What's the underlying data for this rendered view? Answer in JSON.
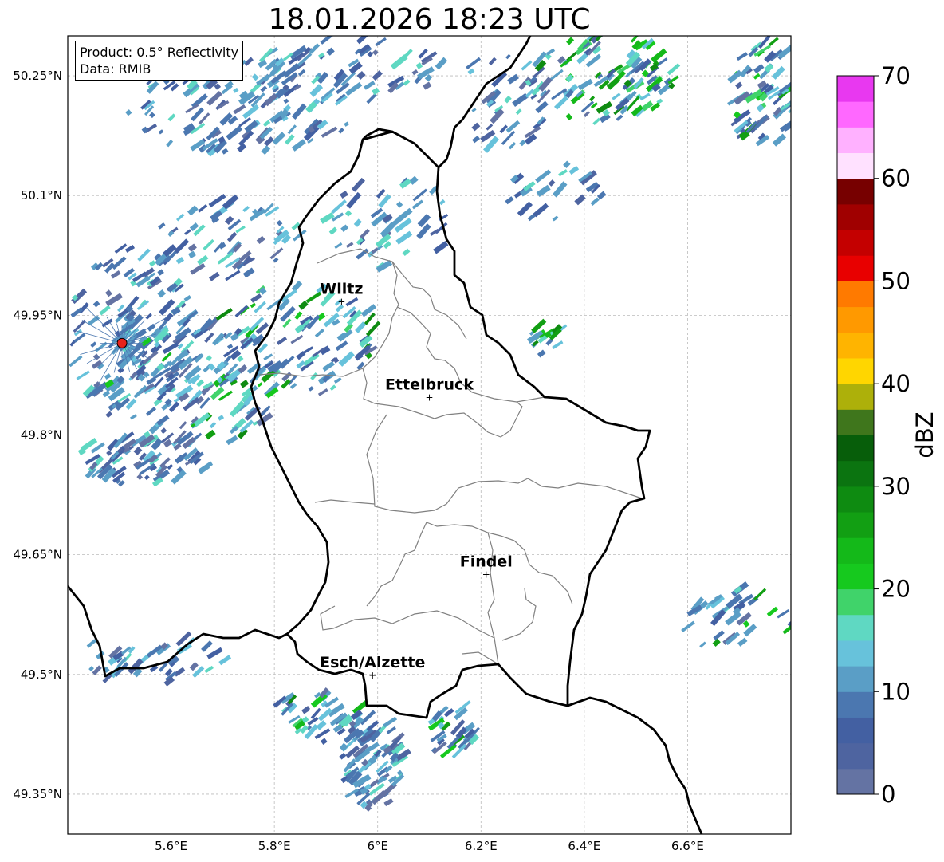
{
  "title": "18.01.2026 18:23 UTC",
  "info": {
    "product": "Product: 0.5° Reflectivity",
    "data": "Data: RMIB"
  },
  "map": {
    "lon_range": [
      5.4,
      6.8
    ],
    "lat_range": [
      49.3,
      50.3
    ],
    "lon_ticks": [
      {
        "value": 5.6,
        "label": "5.6°E"
      },
      {
        "value": 5.8,
        "label": "5.8°E"
      },
      {
        "value": 6.0,
        "label": "6°E"
      },
      {
        "value": 6.2,
        "label": "6.2°E"
      },
      {
        "value": 6.4,
        "label": "6.4°E"
      },
      {
        "value": 6.6,
        "label": "6.6°E"
      }
    ],
    "lat_ticks": [
      {
        "value": 50.25,
        "label": "50.25°N"
      },
      {
        "value": 50.1,
        "label": "50.1°N"
      },
      {
        "value": 49.95,
        "label": "49.95°N"
      },
      {
        "value": 49.8,
        "label": "49.8°N"
      },
      {
        "value": 49.65,
        "label": "49.65°N"
      },
      {
        "value": 49.5,
        "label": "49.5°N"
      },
      {
        "value": 49.35,
        "label": "49.35°N"
      }
    ],
    "cities": [
      {
        "name": "Wiltz",
        "lon": 5.93,
        "lat": 49.967
      },
      {
        "name": "Ettelbruck",
        "lon": 6.1,
        "lat": 49.847
      },
      {
        "name": "Findel",
        "lon": 6.21,
        "lat": 49.625
      },
      {
        "name": "Esch/Alzette",
        "lon": 5.99,
        "lat": 49.499
      }
    ],
    "radar_site": {
      "lon": 5.505,
      "lat": 49.915
    },
    "colors": {
      "border": "#000000",
      "cantons": "#808080",
      "grid": "#bbbbbb",
      "radar_marker": "#e8231c"
    }
  },
  "colorbar": {
    "label": "dBZ",
    "min": 0,
    "max": 70,
    "ticks": [
      0,
      10,
      20,
      30,
      40,
      50,
      60,
      70
    ],
    "colors": [
      "#6473a3",
      "#4e64a0",
      "#4360a2",
      "#4b77b0",
      "#5a9ec6",
      "#67c2db",
      "#5fd8c2",
      "#40d36a",
      "#16c91e",
      "#14b919",
      "#129f13",
      "#0e8b11",
      "#0b7410",
      "#075e0a",
      "#3f761c",
      "#adb00a",
      "#ffd600",
      "#ffb400",
      "#ff9900",
      "#ff7a00",
      "#e80000",
      "#c40000",
      "#a00000",
      "#770000",
      "#ffe1ff",
      "#ffb1ff",
      "#ff68ff",
      "#e838f0"
    ]
  }
}
